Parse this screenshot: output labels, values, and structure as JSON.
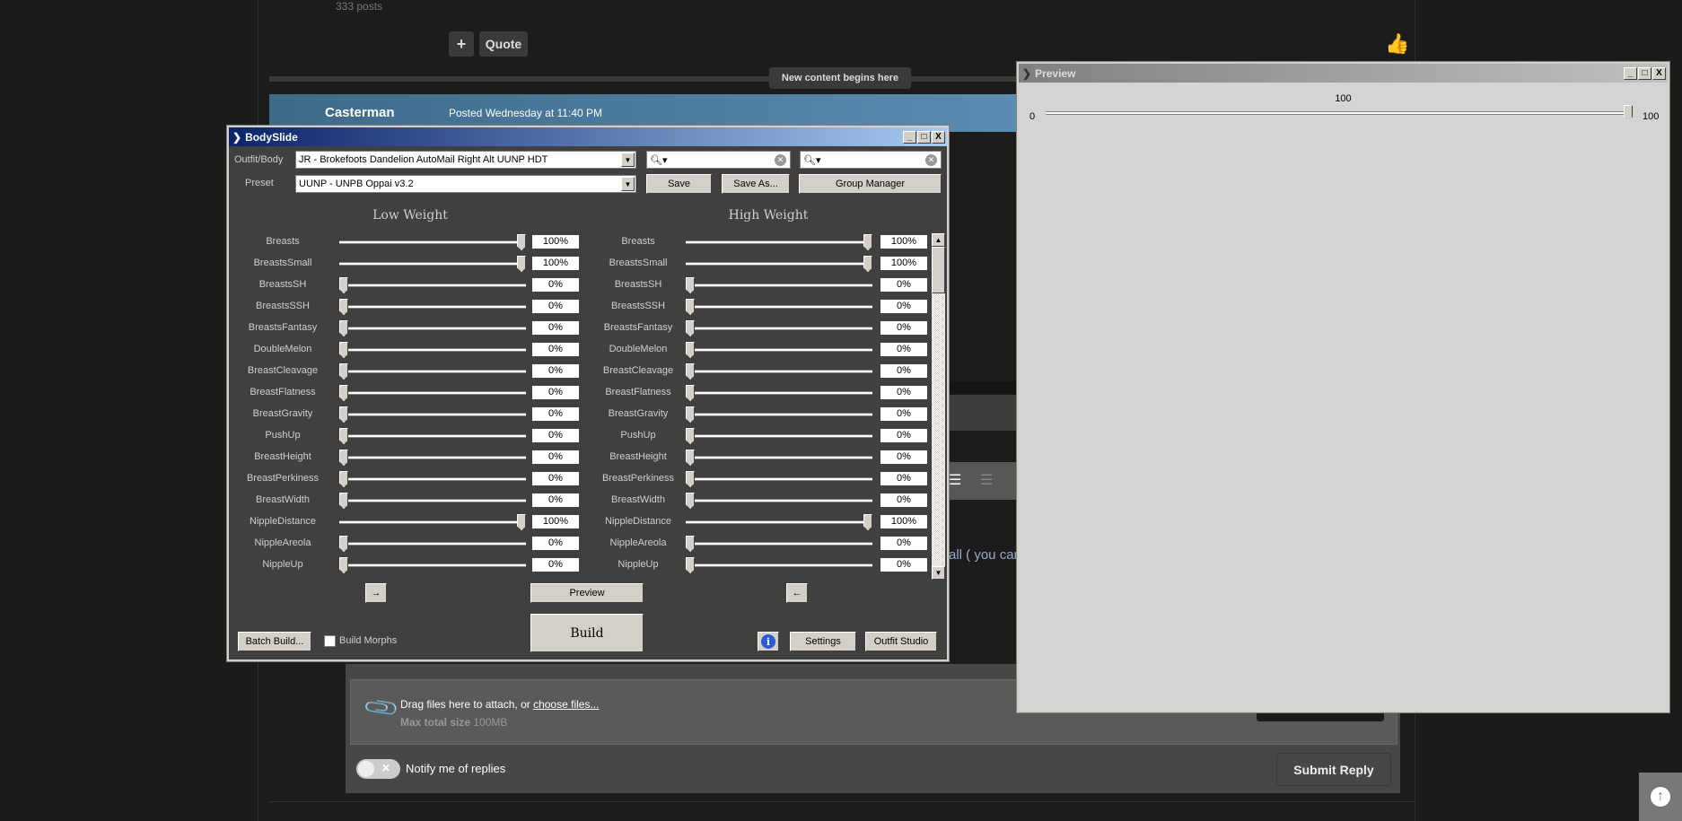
{
  "forum": {
    "posts_count": "333 posts",
    "plus_label": "+",
    "quote_label": "Quote",
    "new_content": "New content begins here",
    "author": "Casterman",
    "posted": "Posted Wednesday at 11:40 PM",
    "editor_snippet": "all ( you can",
    "attach_text": "Drag files here to attach, or ",
    "attach_link": "choose files...",
    "max_size_label": "Max total size",
    "max_size_value": "100MB",
    "notify_label": "Notify me of replies",
    "submit_label": "Submit Reply"
  },
  "bodyslide": {
    "title": "BodySlide",
    "outfit_label": "Outfit/Body",
    "outfit_value": "JR - Brokefoots Dandelion AutoMail Right Alt UUNP HDT",
    "preset_label": "Preset",
    "preset_value": "UUNP - UNPB Oppai v3.2",
    "search1_placeholder": "",
    "search2_placeholder": "",
    "save_label": "Save",
    "save_as_label": "Save As...",
    "group_manager_label": "Group Manager",
    "low_header": "Low Weight",
    "high_header": "High Weight",
    "sliders": [
      {
        "name": "Breasts",
        "low": 100,
        "high": 100
      },
      {
        "name": "BreastsSmall",
        "low": 100,
        "high": 100
      },
      {
        "name": "BreastsSH",
        "low": 0,
        "high": 0
      },
      {
        "name": "BreastsSSH",
        "low": 0,
        "high": 0
      },
      {
        "name": "BreastsFantasy",
        "low": 0,
        "high": 0
      },
      {
        "name": "DoubleMelon",
        "low": 0,
        "high": 0
      },
      {
        "name": "BreastCleavage",
        "low": 0,
        "high": 0
      },
      {
        "name": "BreastFlatness",
        "low": 0,
        "high": 0
      },
      {
        "name": "BreastGravity",
        "low": 0,
        "high": 0
      },
      {
        "name": "PushUp",
        "low": 0,
        "high": 0
      },
      {
        "name": "BreastHeight",
        "low": 0,
        "high": 0
      },
      {
        "name": "BreastPerkiness",
        "low": 0,
        "high": 0
      },
      {
        "name": "BreastWidth",
        "low": 0,
        "high": 0
      },
      {
        "name": "NippleDistance",
        "low": 100,
        "high": 100
      },
      {
        "name": "NippleAreola",
        "low": 0,
        "high": 0
      },
      {
        "name": "NippleUp",
        "low": 0,
        "high": 0
      }
    ],
    "copy_right_label": "→",
    "copy_left_label": "←",
    "preview_label": "Preview",
    "build_label": "Build",
    "batch_build_label": "Batch Build...",
    "build_morphs_label": "Build Morphs",
    "build_morphs_checked": false,
    "settings_label": "Settings",
    "outfit_studio_label": "Outfit Studio"
  },
  "preview": {
    "title": "Preview",
    "slider_value": "100",
    "slider_min": "0",
    "slider_max": "100",
    "slider_fraction": 1.0
  },
  "colors": {
    "titlebar_active": "#0a246a",
    "window_bg": "#404040",
    "preview_bg": "#d4d4d4"
  }
}
